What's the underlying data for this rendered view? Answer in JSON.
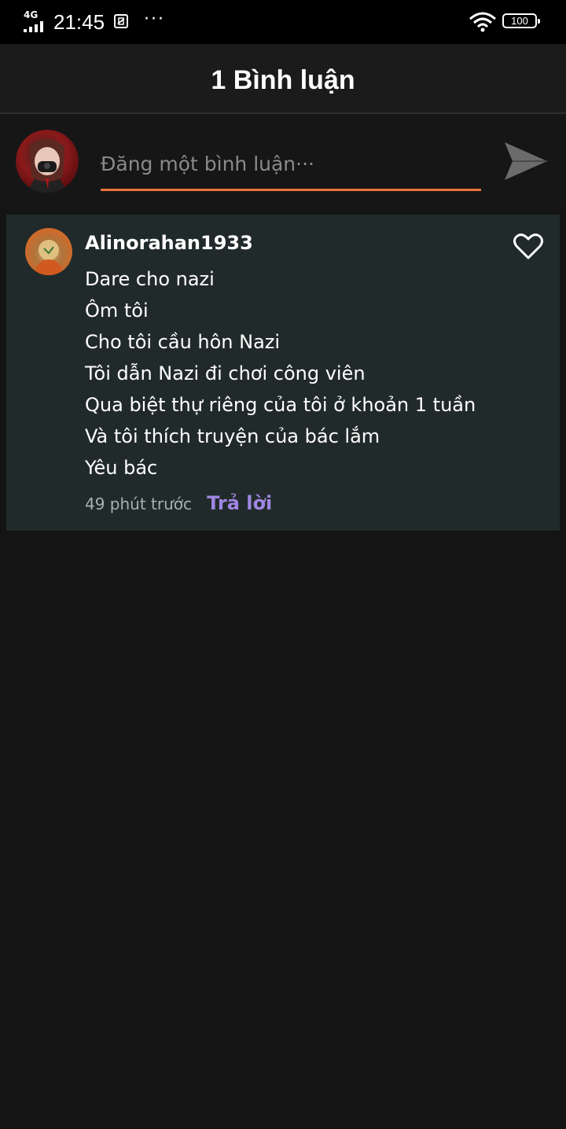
{
  "status_bar": {
    "network": "4G",
    "time": "21:45",
    "more": "···",
    "battery": "100"
  },
  "header": {
    "title": "1 Bình luận"
  },
  "compose": {
    "placeholder": "Đăng một bình luận···",
    "accent_color": "#e8743b"
  },
  "comments": [
    {
      "username": "Alinorahan1933",
      "lines": [
        "Dare cho nazi",
        "Ôm tôi",
        "Cho tôi cầu hôn Nazi",
        "Tôi dẫn Nazi đi chơi công viên",
        "Qua biệt thự riêng của tôi ở khoản 1 tuần",
        "Và tôi thích truyện của bác lắm",
        "Yêu bác"
      ],
      "time": "49 phút trước",
      "reply_label": "Trả lời"
    }
  ],
  "icons": [
    "signal-icon",
    "screenshot-icon",
    "wifi-icon",
    "battery-icon",
    "send-icon",
    "heart-icon"
  ],
  "colors": {
    "background": "#141414",
    "card": "#212a2a",
    "reply": "#9f86e3"
  }
}
